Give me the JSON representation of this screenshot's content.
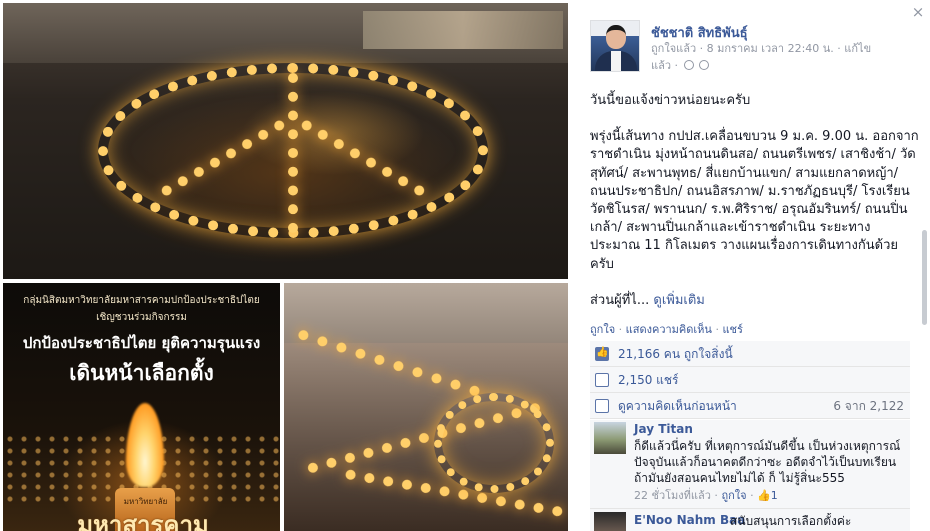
{
  "post": {
    "author": "ชัชชาติ สิทธิพันธุ์",
    "meta_line1": "ถูกใจแล้ว · 8 มกราคม เวลา 22:40 น. · แก้ไข",
    "meta_line2": "แล้ว ·",
    "privacy_icon": "clock-icon, globe-icon",
    "body_p1": "วันนี้ขอแจ้งข่าวหน่อยนะครับ",
    "body_p2": "พรุ่งนี้เส้นทาง กปปส.เคลื่อนขบวน 9 ม.ค. 9.00 น. ออกจากราชดำเนิน มุ่งหน้าถนนดินสอ/ ถนนตรีเพชร/ เสาชิงช้า/ วัดสุทัศน์/ สะพานพุทธ/ สี่แยกบ้านแขก/ สามแยกลาดหญ้า/ ถนนประชาธิปก/ ถนนอิสรภาพ/ ม.ราชภัฏธนบุรี/ โรงเรียนวัดชิโนรส/ พรานนก/ ร.พ.ศิริราช/ อรุณอัมรินทร์/ ถนนปิ่นเกล้า/ สะพานปิ่นเกล้าและเข้าราชดำเนิน ระยะทางประมาณ 11 กิโลเมตร วางแผนเรื่องการเดินทางกันด้วยครับ",
    "body_p3": "ส่วนผู้ที่ไ...",
    "see_more": "ดูเพิ่มเติม"
  },
  "actions": {
    "like": "ถูกใจ",
    "comment": "แสดงความคิดเห็น",
    "share": "แชร์",
    "sep": "·"
  },
  "ufi": {
    "likes": "21,166 คน ถูกใจสิ่งนี้",
    "shares": "2,150 แชร์",
    "previous_comments": "ดูความคิดเห็นก่อนหน้า",
    "comment_count": "6 จาก 2,122"
  },
  "comments": [
    {
      "name": "Jay Titan",
      "text": "ก็ดีแล้วนี่ครับ ที่เหตุการณ์มันดีขึ้น เป็นห่วงเหตุการณ์ปัจจุบันแล้วก็อนาคตดีกว่าซะ อดีตจำไว้เป็นบทเรียน ถ้ามันยังสอนคนไทยไม่ได้ ก็ ไม่รู้สิ่นะ555",
      "time": "22 ชั่วโมงที่แล้ว",
      "like": "ถูกใจ",
      "like_count": "1"
    },
    {
      "name": "E'Noo Nahm Baa",
      "text": "สนับสนุนการเลือกตั้งค่ะ"
    }
  ],
  "photos": {
    "poster_line1": "กลุ่มนิสิตมหาวิทยาลัยมหาสารคามปกป้องประชาธิปไตย",
    "poster_line2": "เชิญชวนร่วมกิจกรรม",
    "poster_title1": "ปกป้องประชาธิปไตย ยุติความรุนแรง",
    "poster_title2": "เดินหน้าเลือกตั้ง",
    "poster_small": "มหาวิทยาลัย",
    "poster_bottom": "มหาสารคาม"
  },
  "close_symbol": "×",
  "colors": {
    "link": "#3b5998",
    "meta": "#9197a3",
    "ufi_bg": "#f6f7f9"
  }
}
